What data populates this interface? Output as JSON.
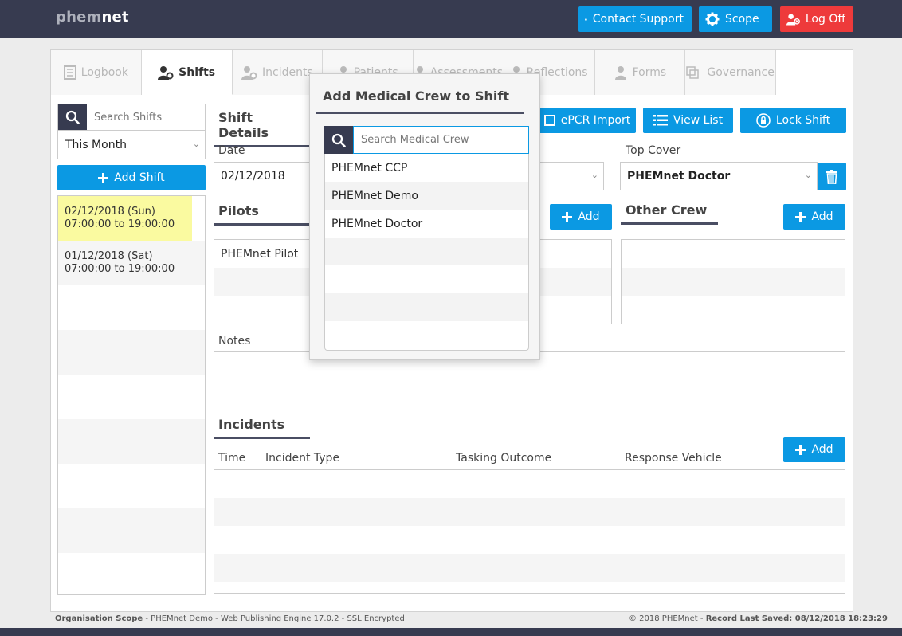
{
  "app": {
    "logo_a": "phem",
    "logo_b": "net"
  },
  "topbar": {
    "contact_label": "Contact Support",
    "scope_label": "Scope",
    "logoff_label": "Log Off"
  },
  "tabs": [
    {
      "label": "Logbook",
      "icon": "book-icon"
    },
    {
      "label": "Shifts",
      "icon": "shift-icon"
    },
    {
      "label": "Incidents",
      "icon": "incident-icon"
    },
    {
      "label": "Patients",
      "icon": "patient-icon"
    },
    {
      "label": "Assessments",
      "icon": "assessment-icon"
    },
    {
      "label": "Reflections",
      "icon": "reflection-icon"
    },
    {
      "label": "Forms",
      "icon": "form-icon"
    },
    {
      "label": "Governance",
      "icon": "governance-icon"
    }
  ],
  "sidebar": {
    "search_placeholder": "Search Shifts",
    "filter_value": "This Month",
    "add_shift_label": "Add Shift",
    "shifts": [
      {
        "date": "02/12/2018 (Sun)",
        "time": "07:00:00 to 19:00:00"
      },
      {
        "date": "01/12/2018 (Sat)",
        "time": "07:00:00 to 19:00:00"
      }
    ]
  },
  "details": {
    "title": "Shift Details",
    "epcr_label": "ePCR Import",
    "viewlist_label": "View List",
    "lock_label": "Lock Shift",
    "date_label": "Date",
    "date_value": "02/12/2018",
    "topcover_label": "Top Cover",
    "topcover_value": "PHEMnet Doctor",
    "pilots_title": "Pilots",
    "pilots_add": "Add",
    "pilots": [
      "PHEMnet Pilot"
    ],
    "othercrew_title": "Other Crew",
    "othercrew_add": "Add",
    "notes_label": "Notes",
    "incidents_title": "Incidents",
    "incidents_add": "Add",
    "columns": [
      "Time",
      "Incident Type",
      "Tasking Outcome",
      "Response Vehicle"
    ]
  },
  "popup": {
    "title": "Add Medical Crew to Shift",
    "search_placeholder": "Search Medical Crew",
    "items": [
      "PHEMnet CCP",
      "PHEMnet Demo",
      "PHEMnet Doctor"
    ]
  },
  "footer": {
    "left_bold": "Organisation Scope",
    "left_text": " - PHEMnet Demo - Web Publishing Engine 17.0.2 - SSL Encrypted",
    "right_text": "© 2018 PHEMnet - ",
    "right_bold": "Record Last Saved: 08/12/2018 18:23:29"
  },
  "colors": {
    "accent": "#0b99e3",
    "danger": "#ee3a3b",
    "navy": "#373b50",
    "highlight": "#fafaa0"
  }
}
